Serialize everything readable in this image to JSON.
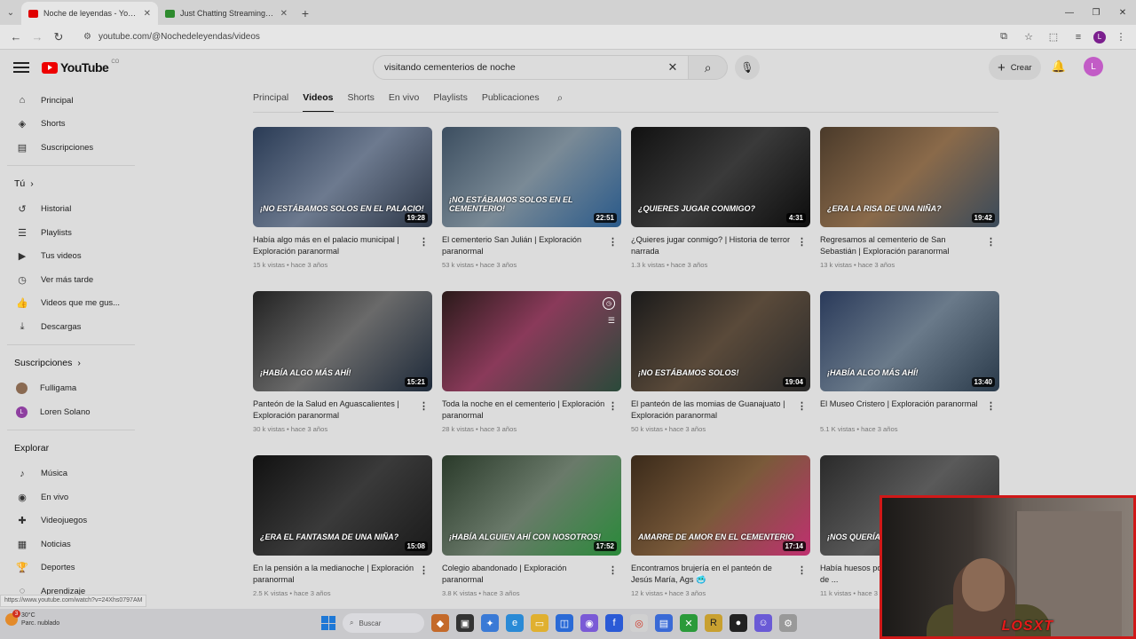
{
  "browser": {
    "tabs": [
      {
        "title": "Noche de leyendas - YouTube",
        "favicon_color": "#e00000",
        "active": true
      },
      {
        "title": "Just Chatting Streaming - Live",
        "favicon_color": "#2e8b2e",
        "active": false
      }
    ],
    "url": "youtube.com/@Nochedeleyendas/videos",
    "profile_initial": "L"
  },
  "youtube": {
    "logo_text": "YouTube",
    "logo_suffix": "CO",
    "search_query": "visitando cementerios de noche",
    "create_label": "Crear",
    "avatar_initial": "L"
  },
  "sidebar": {
    "main": [
      {
        "label": "Principal",
        "icon": "home-icon"
      },
      {
        "label": "Shorts",
        "icon": "shorts-icon"
      },
      {
        "label": "Suscripciones",
        "icon": "subscriptions-icon"
      }
    ],
    "you_header": "Tú",
    "you": [
      {
        "label": "Historial",
        "icon": "history-icon"
      },
      {
        "label": "Playlists",
        "icon": "playlists-icon"
      },
      {
        "label": "Tus videos",
        "icon": "your-videos-icon"
      },
      {
        "label": "Ver más tarde",
        "icon": "watch-later-icon"
      },
      {
        "label": "Videos que me gus...",
        "icon": "liked-icon"
      },
      {
        "label": "Descargas",
        "icon": "downloads-icon"
      }
    ],
    "subs_header": "Suscripciones",
    "subs": [
      {
        "label": "Fulligama",
        "color": "#8a6a52",
        "initial": ""
      },
      {
        "label": "Loren Solano",
        "color": "#8e3fa0",
        "initial": "L"
      }
    ],
    "explore_header": "Explorar",
    "explore": [
      {
        "label": "Música",
        "icon": "music-icon"
      },
      {
        "label": "En vivo",
        "icon": "live-icon"
      },
      {
        "label": "Videojuegos",
        "icon": "gaming-icon"
      },
      {
        "label": "Noticias",
        "icon": "news-icon"
      },
      {
        "label": "Deportes",
        "icon": "sports-icon"
      },
      {
        "label": "Aprendizaje",
        "icon": "learning-icon"
      }
    ]
  },
  "chips": [
    "Principal",
    "Videos",
    "Shorts",
    "En vivo",
    "Playlists",
    "Publicaciones"
  ],
  "selected_chip": "Videos",
  "videos": [
    {
      "title": "Había algo más en el palacio municipal | Exploración paranormal",
      "meta": "15 k vistas • hace 3 años",
      "duration": "19:28",
      "overlay": "¡No estábamos solos en el palacio!",
      "bg": "linear-gradient(135deg,#2a3b55,#6d7a8f 50%,#2c3646)"
    },
    {
      "title": "El cementerio San Julián | Exploración paranormal",
      "meta": "53 k vistas • hace 3 años",
      "duration": "22:51",
      "overlay": "¡No estábamos solos en el cementerio!",
      "bg": "linear-gradient(135deg,#3c4e60,#7a8a96 50%,#2a5a8a)"
    },
    {
      "title": "¿Quieres jugar conmigo? | Historia de terror narrada",
      "meta": "1.3 k vistas • hace 3 años",
      "duration": "4:31",
      "overlay": "¿Quieres jugar conmigo?",
      "bg": "linear-gradient(135deg,#111,#3a3a3a 50%,#0d0d0d)"
    },
    {
      "title": "Regresamos al cementerio de San Sebastián | Exploración paranormal",
      "meta": "13 k vistas • hace 3 años",
      "duration": "19:42",
      "overlay": "¿Era la risa de una niña?",
      "bg": "linear-gradient(135deg,#4a3a2a,#8a6a4a 50%,#3a4a5a)"
    },
    {
      "title": "Panteón de la Salud en Aguascalientes | Exploración paranormal",
      "meta": "30 k vistas • hace 3 años",
      "duration": "15:21",
      "overlay": "¡Había algo más ahí!",
      "bg": "linear-gradient(135deg,#222,#6a6a6a 50%,#1e2a3a)"
    },
    {
      "title": "Toda la noche en el cementerio | Exploración paranormal",
      "meta": "28 k vistas • hace 3 años",
      "duration": "",
      "overlay": "",
      "bg": "linear-gradient(135deg,#2a1a1a,#8a3a5a 45%,#2a4a3a)"
    },
    {
      "title": "El panteón de las momias de Guanajuato | Exploración paranormal",
      "meta": "50 k vistas • hace 3 años",
      "duration": "19:04",
      "overlay": "¡No estábamos solos!",
      "bg": "linear-gradient(135deg,#1a1a1a,#5a4a3a 50%,#2a2a2a)"
    },
    {
      "title": "El Museo Cristero | Exploración paranormal",
      "meta": "5.1 K vistas • hace 3 años",
      "duration": "13:40",
      "overlay": "¡Había algo más ahí!",
      "bg": "linear-gradient(135deg,#2a3a5a,#6a7a8a 50%,#2a3a4a)"
    },
    {
      "title": "En la pensión a la medianoche | Exploración paranormal",
      "meta": "2.5 K vistas • hace 3 años",
      "duration": "15:08",
      "overlay": "¿Era el fantasma de una niña?",
      "bg": "linear-gradient(135deg,#111,#3a3a3a 50%,#1a1a1a)"
    },
    {
      "title": "Colegio abandonado | Exploración paranormal",
      "meta": "3.8 K vistas • hace 3 años",
      "duration": "17:52",
      "overlay": "¡Había alguien ahí con nosotros!",
      "bg": "linear-gradient(135deg,#2a3a2a,#6a7a6a 50%,#2a8a3a)"
    },
    {
      "title": "Encontramos brujería en el panteón de Jesús María, Ags 🥶",
      "meta": "12 k vistas • hace 3 años",
      "duration": "17:14",
      "overlay": "Amarre de amor en el cementerio",
      "bg": "linear-gradient(135deg,#3a2a1a,#7a5a3a 50%,#c03070)"
    },
    {
      "title": "Había huesos por todos lados | Abandonado de ...",
      "meta": "11 k vistas • hace 3 años",
      "duration": "",
      "overlay": "¡Nos querían fuera!",
      "bg": "linear-gradient(135deg,#2a2a2a,#5a5a5a 50%,#2a2a2a)"
    }
  ],
  "status_url": "https://www.youtube.com/watch?v=24Xhs0797AM",
  "taskbar": {
    "weather_temp": "30°C",
    "weather_desc": "Parc. nublado",
    "weather_badge": "3",
    "search_placeholder": "Buscar"
  },
  "webcam": {
    "overlay_text": "LOSXT"
  }
}
